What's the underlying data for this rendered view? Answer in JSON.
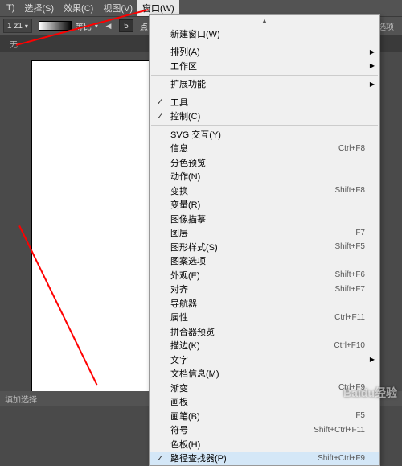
{
  "menubar": {
    "items": [
      {
        "label": "T)"
      },
      {
        "label": "选择(S)"
      },
      {
        "label": "效果(C)"
      },
      {
        "label": "视图(V)"
      },
      {
        "label": "窗口(W)"
      }
    ]
  },
  "toolbar": {
    "layer_value": "1 z1",
    "stroke_label": "等比",
    "sides_value": "5",
    "shape_label": "点 圆形",
    "right_label": "选项"
  },
  "tabs": {
    "current": "无"
  },
  "statusbar": {
    "text": "填加选择"
  },
  "watermark": "Baidu经验",
  "menu": {
    "top_arrow": "▲",
    "items": [
      {
        "label": "新建窗口(W)",
        "shortcut": "",
        "check": "",
        "sub": false,
        "sep": false
      },
      {
        "sep": true
      },
      {
        "label": "排列(A)",
        "shortcut": "",
        "check": "",
        "sub": true,
        "sep": false
      },
      {
        "label": "工作区",
        "shortcut": "",
        "check": "",
        "sub": true,
        "sep": false
      },
      {
        "sep": true
      },
      {
        "label": "扩展功能",
        "shortcut": "",
        "check": "",
        "sub": true,
        "sep": false
      },
      {
        "sep": true
      },
      {
        "label": "工具",
        "shortcut": "",
        "check": "✓",
        "sub": false,
        "sep": false
      },
      {
        "label": "控制(C)",
        "shortcut": "",
        "check": "✓",
        "sub": false,
        "sep": false
      },
      {
        "sep": true
      },
      {
        "label": "SVG 交互(Y)",
        "shortcut": "",
        "check": "",
        "sub": false,
        "sep": false
      },
      {
        "label": "信息",
        "shortcut": "Ctrl+F8",
        "check": "",
        "sub": false,
        "sep": false
      },
      {
        "label": "分色预览",
        "shortcut": "",
        "check": "",
        "sub": false,
        "sep": false
      },
      {
        "label": "动作(N)",
        "shortcut": "",
        "check": "",
        "sub": false,
        "sep": false
      },
      {
        "label": "变换",
        "shortcut": "Shift+F8",
        "check": "",
        "sub": false,
        "sep": false
      },
      {
        "label": "变量(R)",
        "shortcut": "",
        "check": "",
        "sub": false,
        "sep": false
      },
      {
        "label": "图像描摹",
        "shortcut": "",
        "check": "",
        "sub": false,
        "sep": false
      },
      {
        "label": "图层",
        "shortcut": "F7",
        "check": "",
        "sub": false,
        "sep": false
      },
      {
        "label": "图形样式(S)",
        "shortcut": "Shift+F5",
        "check": "",
        "sub": false,
        "sep": false
      },
      {
        "label": "图案选项",
        "shortcut": "",
        "check": "",
        "sub": false,
        "sep": false
      },
      {
        "label": "外观(E)",
        "shortcut": "Shift+F6",
        "check": "",
        "sub": false,
        "sep": false
      },
      {
        "label": "对齐",
        "shortcut": "Shift+F7",
        "check": "",
        "sub": false,
        "sep": false
      },
      {
        "label": "导航器",
        "shortcut": "",
        "check": "",
        "sub": false,
        "sep": false
      },
      {
        "label": "属性",
        "shortcut": "Ctrl+F11",
        "check": "",
        "sub": false,
        "sep": false
      },
      {
        "label": "拼合器预览",
        "shortcut": "",
        "check": "",
        "sub": false,
        "sep": false
      },
      {
        "label": "描边(K)",
        "shortcut": "Ctrl+F10",
        "check": "",
        "sub": false,
        "sep": false
      },
      {
        "label": "文字",
        "shortcut": "",
        "check": "",
        "sub": true,
        "sep": false
      },
      {
        "label": "文档信息(M)",
        "shortcut": "",
        "check": "",
        "sub": false,
        "sep": false
      },
      {
        "label": "渐变",
        "shortcut": "Ctrl+F9",
        "check": "",
        "sub": false,
        "sep": false
      },
      {
        "label": "画板",
        "shortcut": "",
        "check": "",
        "sub": false,
        "sep": false
      },
      {
        "label": "画笔(B)",
        "shortcut": "F5",
        "check": "",
        "sub": false,
        "sep": false
      },
      {
        "label": "符号",
        "shortcut": "Shift+Ctrl+F11",
        "check": "",
        "sub": false,
        "sep": false
      },
      {
        "label": "色板(H)",
        "shortcut": "",
        "check": "",
        "sub": false,
        "sep": false
      },
      {
        "label": "路径查找器(P)",
        "shortcut": "Shift+Ctrl+F9",
        "check": "✓",
        "sub": false,
        "sep": false,
        "sel": true
      }
    ]
  }
}
